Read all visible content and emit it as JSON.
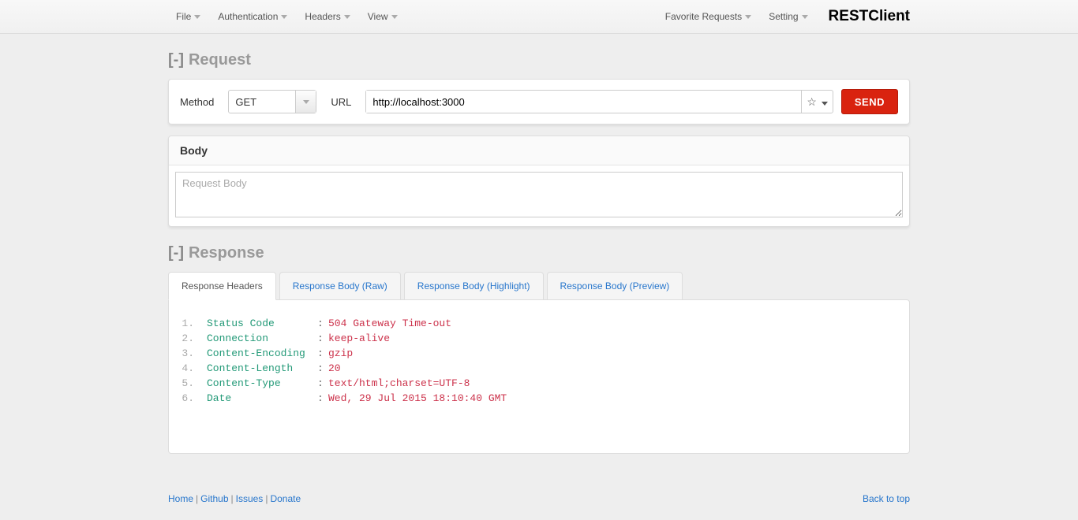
{
  "menu": {
    "left": [
      "File",
      "Authentication",
      "Headers",
      "View"
    ],
    "right": [
      "Favorite Requests",
      "Setting"
    ]
  },
  "brand": "RESTClient",
  "request": {
    "section_label": "Request",
    "method_label": "Method",
    "method_value": "GET",
    "url_label": "URL",
    "url_value": "http://localhost:3000",
    "send_label": "SEND",
    "body_title": "Body",
    "body_placeholder": "Request Body"
  },
  "response": {
    "section_label": "Response",
    "tabs": [
      "Response Headers",
      "Response Body (Raw)",
      "Response Body (Highlight)",
      "Response Body (Preview)"
    ],
    "active_tab": 0,
    "headers": [
      {
        "name": "Status Code",
        "value": "504 Gateway Time-out"
      },
      {
        "name": "Connection",
        "value": "keep-alive"
      },
      {
        "name": "Content-Encoding",
        "value": "gzip"
      },
      {
        "name": "Content-Length",
        "value": "20"
      },
      {
        "name": "Content-Type",
        "value": "text/html;charset=UTF-8"
      },
      {
        "name": "Date",
        "value": "Wed, 29 Jul 2015 18:10:40 GMT"
      }
    ]
  },
  "footer": {
    "links": [
      "Home",
      "Github",
      "Issues",
      "Donate"
    ],
    "back_to_top": "Back to top"
  }
}
